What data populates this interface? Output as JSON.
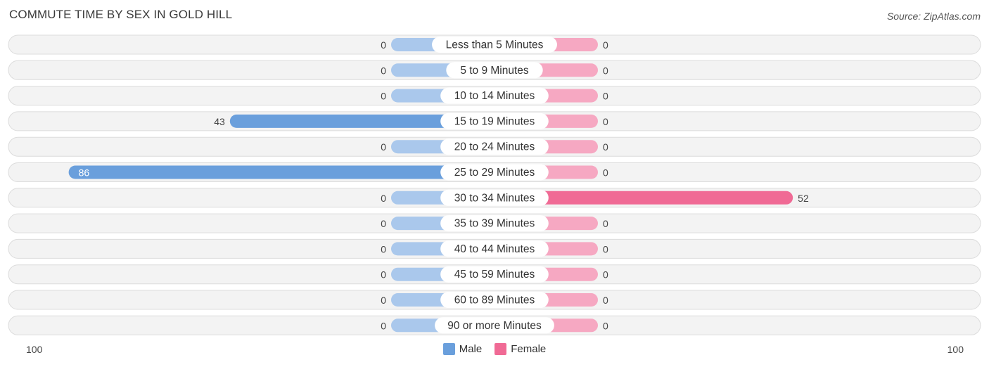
{
  "header": {
    "title": "COMMUTE TIME BY SEX IN GOLD HILL",
    "source": "Source: ZipAtlas.com"
  },
  "colors": {
    "male": "#6a9fdc",
    "male_light": "#aac8ec",
    "female": "#f06a95",
    "female_light": "#f6a8c2"
  },
  "legend": {
    "male_label": "Male",
    "female_label": "Female"
  },
  "axis": {
    "left_label": "100",
    "right_label": "100"
  },
  "chart_data": {
    "type": "bar",
    "orientation": "horizontal-diverging",
    "title": "COMMUTE TIME BY SEX IN GOLD HILL",
    "xlabel": "",
    "ylabel": "",
    "xlim": [
      -100,
      100
    ],
    "legend_position": "bottom-center",
    "categories": [
      "Less than 5 Minutes",
      "5 to 9 Minutes",
      "10 to 14 Minutes",
      "15 to 19 Minutes",
      "20 to 24 Minutes",
      "25 to 29 Minutes",
      "30 to 34 Minutes",
      "35 to 39 Minutes",
      "40 to 44 Minutes",
      "45 to 59 Minutes",
      "60 to 89 Minutes",
      "90 or more Minutes"
    ],
    "series": [
      {
        "name": "Male",
        "values": [
          0,
          0,
          0,
          43,
          0,
          86,
          0,
          0,
          0,
          0,
          0,
          0
        ]
      },
      {
        "name": "Female",
        "values": [
          0,
          0,
          0,
          0,
          0,
          0,
          52,
          0,
          0,
          0,
          0,
          0
        ]
      }
    ]
  }
}
